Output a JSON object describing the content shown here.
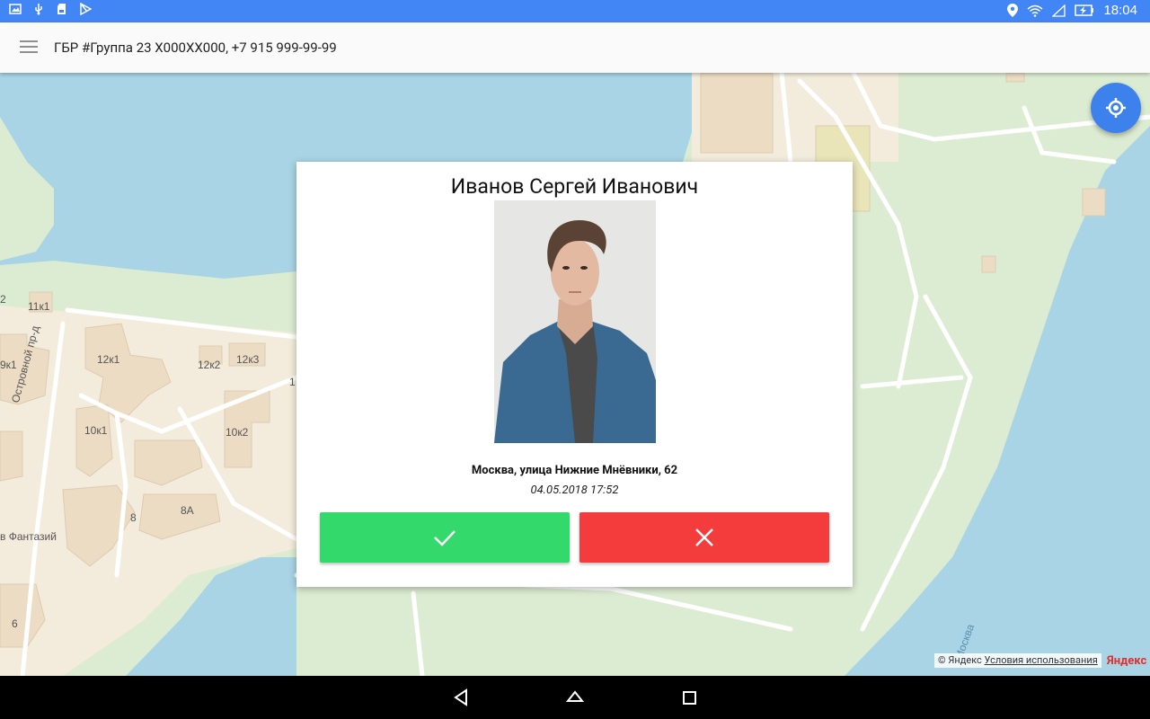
{
  "status_bar": {
    "time": "18:04",
    "left_icons": [
      "image-icon",
      "usb-icon",
      "sd-card-icon",
      "play-store-icon"
    ],
    "right_icons": [
      "location-icon",
      "wifi-icon",
      "no-signal-icon",
      "battery-charging-icon"
    ],
    "background": "#4285f4"
  },
  "app_bar": {
    "menu_icon": "hamburger-menu-icon",
    "title": "ГБР #Группа 23 X000XX000, +7 915 999-99-99"
  },
  "map": {
    "labels": [
      "2",
      "11к1",
      "9к1",
      "12к1",
      "12к2",
      "12к3",
      "10к1",
      "10к2",
      "Островной пр-д",
      "8",
      "8А",
      "в Фантазий",
      "6",
      "1",
      "Москва"
    ],
    "locate_button_icon": "my-location-icon",
    "copyright_text": "© Яндекс",
    "terms_link": "Условия использования",
    "logo": "Яндекс",
    "colors": {
      "water": "#a8d3e4",
      "park": "#dcecd2",
      "building": "#ecdcc3",
      "road": "#ffffff"
    }
  },
  "alarm_dialog": {
    "name": "Иванов Сергей Иванович",
    "photo_icon": "person-photo",
    "address": "Москва, улица Нижние Мнёвники, 62",
    "datetime": "04.05.2018 17:52",
    "accept_icon": "check-icon",
    "reject_icon": "close-icon",
    "accept_color": "#33d96b",
    "reject_color": "#f43c3d"
  },
  "nav_bar": {
    "icons": [
      "back-icon",
      "home-icon",
      "recents-icon"
    ]
  }
}
